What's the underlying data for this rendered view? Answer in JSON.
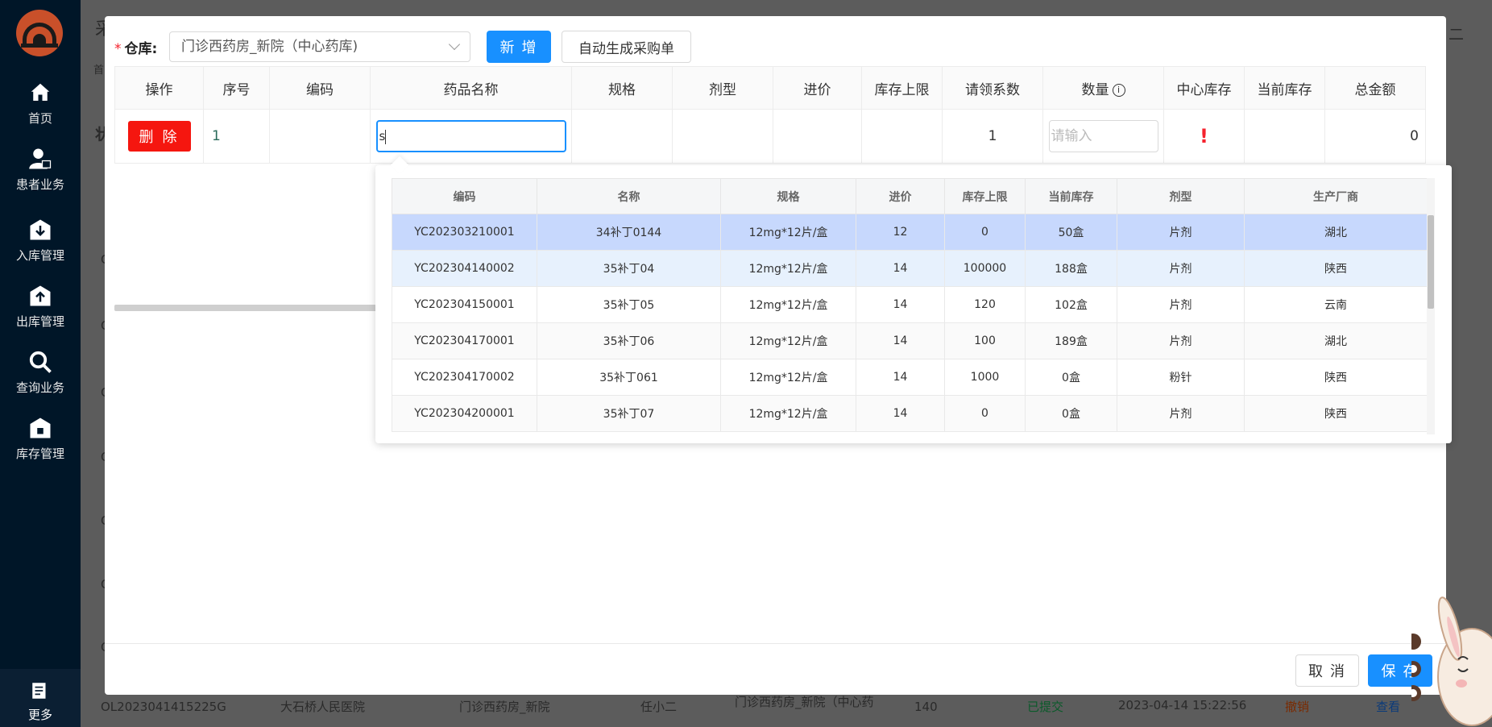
{
  "sidebar": {
    "items": [
      {
        "label": "首页",
        "icon": "home-icon"
      },
      {
        "label": "患者业务",
        "icon": "user-lock-icon"
      },
      {
        "label": "入库管理",
        "icon": "inbound-icon"
      },
      {
        "label": "出库管理",
        "icon": "outbound-icon"
      },
      {
        "label": "查询业务",
        "icon": "search-icon"
      },
      {
        "label": "库存管理",
        "icon": "warehouse-icon"
      }
    ],
    "more_label": "更多"
  },
  "background": {
    "title_char": "采",
    "breadcrumb_first": "首",
    "side_label": "状",
    "row_prefix": "C",
    "bottom_row": [
      "OL2023041415225G",
      "大石桥人民医院",
      "门诊西药房_新院",
      "任小二",
      "门诊西药房_新院（中心药",
      "140",
      "已提交",
      "2023-04-14 15:22:56",
      "撤销",
      "查看"
    ],
    "top_right": "二"
  },
  "modal": {
    "warehouse": {
      "required_mark": "*",
      "label": "仓库:",
      "value": "门诊西药房_新院（中心药库)"
    },
    "add_button": "新 增",
    "auto_button": "自动生成采购单",
    "table": {
      "headers": [
        "操作",
        "序号",
        "编码",
        "药品名称",
        "规格",
        "剂型",
        "进价",
        "库存上限",
        "请领系数",
        "数量",
        "中心库存",
        "当前库存",
        "总金额"
      ],
      "row": {
        "delete_label": "删 除",
        "index": "1",
        "code": "",
        "name_value": "s",
        "spec": "",
        "form": "",
        "price": "",
        "upper": "",
        "coefficient": "1",
        "qty_placeholder": "请输入",
        "center_stock_warn": "!",
        "current_stock": "",
        "total": "0"
      }
    },
    "dropdown": {
      "headers": [
        "编码",
        "名称",
        "规格",
        "进价",
        "库存上限",
        "当前库存",
        "剂型",
        "生产厂商"
      ],
      "rows": [
        [
          "YC202303210001",
          "34补丁0144",
          "12mg*12片/盒",
          "12",
          "0",
          "50盒",
          "片剂",
          "湖北"
        ],
        [
          "YC202304140002",
          "35补丁04",
          "12mg*12片/盒",
          "14",
          "100000",
          "188盒",
          "片剂",
          "陕西"
        ],
        [
          "YC202304150001",
          "35补丁05",
          "12mg*12片/盒",
          "14",
          "120",
          "102盒",
          "片剂",
          "云南"
        ],
        [
          "YC202304170001",
          "35补丁06",
          "12mg*12片/盒",
          "14",
          "100",
          "189盒",
          "片剂",
          "湖北"
        ],
        [
          "YC202304170002",
          "35补丁061",
          "12mg*12片/盒",
          "14",
          "1000",
          "0盒",
          "粉针",
          "陕西"
        ],
        [
          "YC202304200001",
          "35补丁07",
          "12mg*12片/盒",
          "14",
          "0",
          "0盒",
          "片剂",
          "陕西"
        ]
      ]
    },
    "footer": {
      "cancel": "取 消",
      "save": "保 存"
    }
  },
  "colors": {
    "primary": "#1890ff",
    "danger": "#f5160f",
    "sidebar": "#001628",
    "selected_row": "#c7d8fd"
  }
}
